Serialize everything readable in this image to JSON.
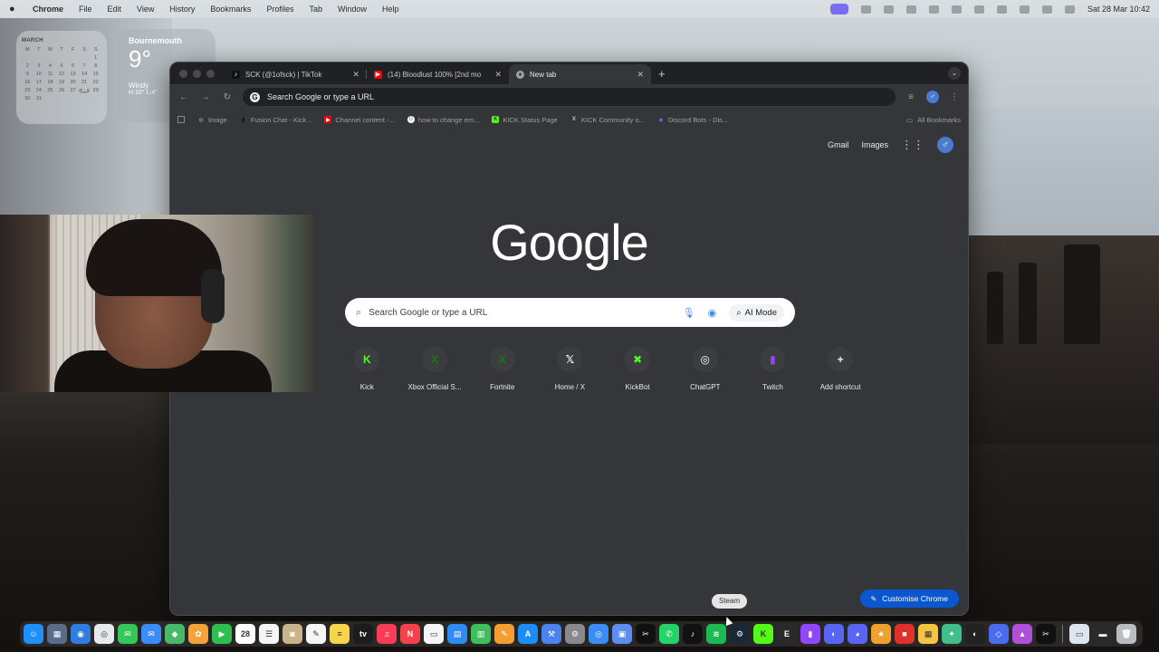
{
  "menubar": {
    "app_name": "Chrome",
    "items": [
      "File",
      "Edit",
      "View",
      "History",
      "Bookmarks",
      "Profiles",
      "Tab",
      "Window",
      "Help"
    ],
    "datetime": "Sat 28 Mar  10:42"
  },
  "calendar_widget": {
    "month": "MARCH",
    "weekdays": [
      "M",
      "T",
      "W",
      "T",
      "F",
      "S",
      "S"
    ],
    "days": [
      "",
      "",
      "",
      "",
      "",
      "",
      "1",
      "2",
      "3",
      "4",
      "5",
      "6",
      "7",
      "8",
      "9",
      "10",
      "11",
      "12",
      "13",
      "14",
      "15",
      "16",
      "17",
      "18",
      "19",
      "20",
      "21",
      "22",
      "23",
      "24",
      "25",
      "26",
      "27",
      "28",
      "29",
      "30",
      "31"
    ],
    "today": "28"
  },
  "weather_widget": {
    "city": "Bournemouth",
    "temp": "9°",
    "condition": "Windy",
    "high_low": "H:10° L:4°"
  },
  "tabs": [
    {
      "title": "SCK (@1ofsck) | TikTok",
      "favicon": "tiktok-icon",
      "active": false
    },
    {
      "title": "(14) Bloodlust 100% [2nd mo",
      "favicon": "youtube-icon",
      "active": false
    },
    {
      "title": "New tab",
      "favicon": "chrome-icon",
      "active": true
    }
  ],
  "toolbar": {
    "omnibox_placeholder": "Search Google or type a URL"
  },
  "bookmarks": [
    {
      "label": "Image",
      "icon": "globe-icon"
    },
    {
      "label": "Fusion Chat - Kick...",
      "icon": "bookmark-icon"
    },
    {
      "label": "Channel content -...",
      "icon": "youtube-icon"
    },
    {
      "label": "how to change em...",
      "icon": "google-icon"
    },
    {
      "label": "KICK Status Page",
      "icon": "kick-icon"
    },
    {
      "label": "KICK Community o...",
      "icon": "x-icon"
    },
    {
      "label": "Discord Bots - Dis...",
      "icon": "discord-icon"
    }
  ],
  "all_bookmarks": "All Bookmarks",
  "ntp": {
    "gmail": "Gmail",
    "images": "Images",
    "logo": "Google",
    "search_placeholder": "Search Google or type a URL",
    "ai_mode": "AI Mode",
    "shortcuts": [
      {
        "label": "Kick",
        "glyph": "K",
        "color": "#53fc18"
      },
      {
        "label": "Xbox Official S...",
        "glyph": "X",
        "color": "#107c10"
      },
      {
        "label": "Fortnite",
        "glyph": "X",
        "color": "#107c10"
      },
      {
        "label": "Home / X",
        "glyph": "𝕏",
        "color": "#ffffff"
      },
      {
        "label": "KickBot",
        "glyph": "✖",
        "color": "#53fc18"
      },
      {
        "label": "ChatGPT",
        "glyph": "◎",
        "color": "#ffffff"
      },
      {
        "label": "Twitch",
        "glyph": "▮",
        "color": "#9146ff"
      },
      {
        "label": "Add shortcut",
        "glyph": "+",
        "color": "#e8eaed"
      }
    ],
    "customise_label": "Customise Chrome"
  },
  "dock_tooltip": "Steam",
  "dock_apps": [
    {
      "name": "finder-icon",
      "color": "#1e90ff",
      "glyph": "☺"
    },
    {
      "name": "launchpad-icon",
      "color": "#5a6c8a",
      "glyph": "▦"
    },
    {
      "name": "safari-icon",
      "color": "#2f7de1",
      "glyph": "◉"
    },
    {
      "name": "chrome-icon",
      "color": "#e8eaed",
      "glyph": "◎"
    },
    {
      "name": "messages-icon",
      "color": "#34c759",
      "glyph": "✉"
    },
    {
      "name": "mail-icon",
      "color": "#3a8cf7",
      "glyph": "✉"
    },
    {
      "name": "maps-icon",
      "color": "#4ab86a",
      "glyph": "◆"
    },
    {
      "name": "photos-icon",
      "color": "#f2a33a",
      "glyph": "✿"
    },
    {
      "name": "facetime-icon",
      "color": "#2fbf4f",
      "glyph": "▶"
    },
    {
      "name": "calendar-icon",
      "color": "#ffffff",
      "glyph": "28"
    },
    {
      "name": "reminders-icon",
      "color": "#f5f5f5",
      "glyph": "☰"
    },
    {
      "name": "contacts-icon",
      "color": "#c9b38a",
      "glyph": "◙"
    },
    {
      "name": "freeform-icon",
      "color": "#f5f5f5",
      "glyph": "✎"
    },
    {
      "name": "notes-icon",
      "color": "#f7d54a",
      "glyph": "≡"
    },
    {
      "name": "tv-icon",
      "color": "#1c1c1c",
      "glyph": "tv"
    },
    {
      "name": "music-icon",
      "color": "#fa3c56",
      "glyph": "♫"
    },
    {
      "name": "news-icon",
      "color": "#f4424b",
      "glyph": "N"
    },
    {
      "name": "keynote-icon",
      "color": "#f5f5f5",
      "glyph": "▭"
    },
    {
      "name": "keynote2-icon",
      "color": "#2f8cf2",
      "glyph": "▤"
    },
    {
      "name": "numbers-icon",
      "color": "#3fbf5b",
      "glyph": "▥"
    },
    {
      "name": "pages-icon",
      "color": "#f59e2f",
      "glyph": "✎"
    },
    {
      "name": "app-store-icon",
      "color": "#1c8cf7",
      "glyph": "A"
    },
    {
      "name": "xcode-icon",
      "color": "#4a82f0",
      "glyph": "⚒"
    },
    {
      "name": "settings-icon",
      "color": "#8a8a8e",
      "glyph": "⚙"
    },
    {
      "name": "browser-icon",
      "color": "#3a8cf7",
      "glyph": "◎"
    },
    {
      "name": "preview-icon",
      "color": "#5b8ef0",
      "glyph": "▣"
    },
    {
      "name": "capcut-icon",
      "color": "#111111",
      "glyph": "✂"
    },
    {
      "name": "whatsapp-icon",
      "color": "#25d366",
      "glyph": "✆"
    },
    {
      "name": "tiktok-icon",
      "color": "#111111",
      "glyph": "♪"
    },
    {
      "name": "spotify-icon",
      "color": "#1db954",
      "glyph": "≋"
    },
    {
      "name": "steam-icon",
      "color": "#1b2838",
      "glyph": "⚙"
    },
    {
      "name": "kick-icon",
      "color": "#53fc18",
      "glyph": "K"
    },
    {
      "name": "epic-icon",
      "color": "#2a2a2a",
      "glyph": "E"
    },
    {
      "name": "twitch-icon",
      "color": "#9146ff",
      "glyph": "▮"
    },
    {
      "name": "obs-icon",
      "color": "#5865f2",
      "glyph": "◐"
    },
    {
      "name": "discord-icon",
      "color": "#5865f2",
      "glyph": "◕"
    },
    {
      "name": "game-icon",
      "color": "#f0a030",
      "glyph": "★"
    },
    {
      "name": "roblox-icon",
      "color": "#e0302a",
      "glyph": "■"
    },
    {
      "name": "minecraft-icon",
      "color": "#f5c542",
      "glyph": "▦"
    },
    {
      "name": "cheat-icon",
      "color": "#3fbf8b",
      "glyph": "✦"
    },
    {
      "name": "among-us-icon",
      "color": "#222222",
      "glyph": "◐"
    },
    {
      "name": "vpn-icon",
      "color": "#4a6cf0",
      "glyph": "◇"
    },
    {
      "name": "lab-icon",
      "color": "#b050d8",
      "glyph": "▲"
    },
    {
      "name": "capcut2-icon",
      "color": "#111111",
      "glyph": "✂"
    },
    {
      "name": "file-icon",
      "color": "#dde6ee",
      "glyph": "▭"
    },
    {
      "name": "battery-icon",
      "color": "#2a2a2a",
      "glyph": "▬"
    },
    {
      "name": "trash-icon",
      "color": "#b9bcc0",
      "glyph": "🗑"
    }
  ]
}
